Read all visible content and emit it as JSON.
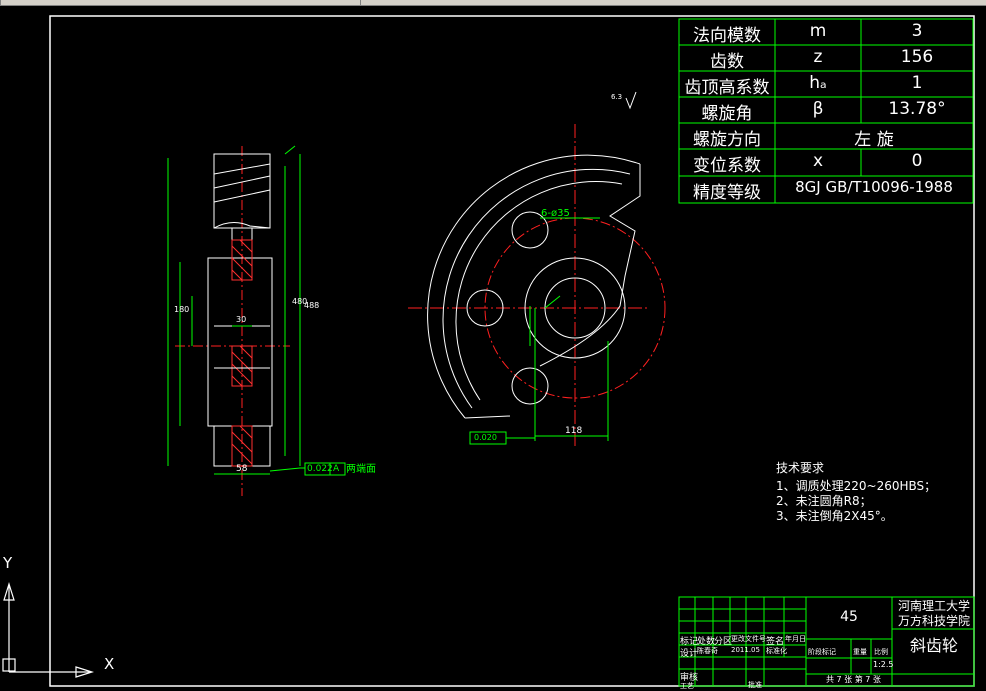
{
  "gear_table": {
    "rows": [
      {
        "name": "法向模数",
        "symbol": "m",
        "value": "3"
      },
      {
        "name": "齿数",
        "symbol": "z",
        "value": "156"
      },
      {
        "name": "齿顶高系数",
        "symbol": "hₐ",
        "value": "1"
      },
      {
        "name": "螺旋角",
        "symbol": "β",
        "value": "13.78°"
      },
      {
        "name": "螺旋方向",
        "merged": "左  旋"
      },
      {
        "name": "变位系数",
        "symbol": "x",
        "value": "0"
      },
      {
        "name": "精度等级",
        "merged": "8GJ GB/T10096-1988"
      }
    ]
  },
  "tech_requirements": {
    "title": "技术要求",
    "items": [
      "1、调质处理220~260HBS；",
      "2、未注圆角R8；",
      "3、未注倒角2X45°。"
    ]
  },
  "title_block": {
    "material": "45",
    "school_line1": "河南理工大学",
    "school_line2": "万方科技学院",
    "part_name": "斜齿轮",
    "scale": "1:2.5",
    "sheets": "共 7 张  第 7 张",
    "row_labels": [
      "标记",
      "处数",
      "分区",
      "更改文件号",
      "签名",
      "年月日"
    ],
    "design_row": [
      "设计",
      "陈春奇",
      "2011.05",
      "标准化"
    ],
    "review": "审核",
    "process": "工艺",
    "approve": "批准",
    "stage_labels": [
      "阶段标记",
      "重量",
      "比例"
    ]
  },
  "dims": {
    "width_58": "58",
    "hub_30": "30",
    "dia_496": "488",
    "dia_480": "480",
    "hub_dia": "180",
    "runout": "0.022",
    "datum": "A",
    "both_faces": "两端面",
    "holes": "6-ø35",
    "dim_118": "118",
    "tol_small": "0.020",
    "roughness": "6.3"
  },
  "ucs": {
    "x": "X",
    "y": "Y"
  }
}
